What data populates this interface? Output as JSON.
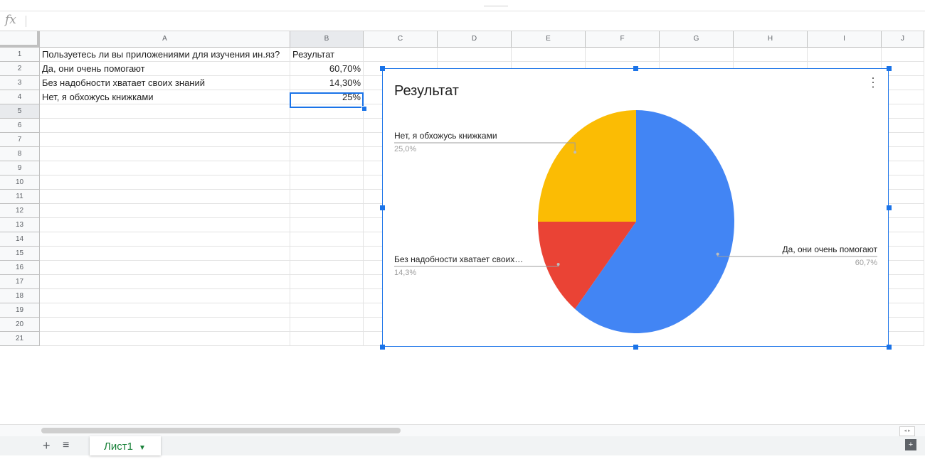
{
  "formula_bar": {
    "label": "fx",
    "value": ""
  },
  "sheet": {
    "columns": [
      "A",
      "B",
      "C",
      "D",
      "E",
      "F",
      "G",
      "H",
      "I",
      "J"
    ],
    "rows": [
      "1",
      "2",
      "3",
      "4",
      "5",
      "6",
      "7",
      "8",
      "9",
      "10",
      "11",
      "12",
      "13",
      "14",
      "15",
      "16",
      "17",
      "18",
      "19",
      "20",
      "21"
    ],
    "cells": {
      "A1": "Пользуетесь ли вы приложениями для изучения ин.яз?",
      "B1": "Результат",
      "A2": "Да, они очень помогают",
      "B2": "60,70%",
      "A3": "Без надобности хватает своих знаний",
      "B3": "14,30%",
      "A4": "Нет, я обхожусь книжками",
      "B4": "25%"
    },
    "selected_cell": "B5"
  },
  "chart": {
    "title": "Результат",
    "menu_icon": "more-vert-icon",
    "colors": [
      "#4285f4",
      "#ea4335",
      "#fbbc04"
    ]
  },
  "chart_data": {
    "type": "pie",
    "title": "Результат",
    "categories": [
      "Да, они очень помогают",
      "Без надобности хватает своих знаний",
      "Нет, я обхожусь книжками"
    ],
    "values": [
      60.7,
      14.3,
      25.0
    ],
    "labels": [
      "Да, они очень помогают",
      "Без надобности хватает своих…",
      "Нет, я обхожусь книжками"
    ],
    "percent_labels": [
      "60,7%",
      "14,3%",
      "25,0%"
    ],
    "colors": [
      "#4285f4",
      "#ea4335",
      "#fbbc04"
    ],
    "legend": "labeled"
  },
  "bottom": {
    "add_icon": "plus-icon",
    "list_icon": "list-icon",
    "tab_label": "Лист1",
    "explore_icon": "explore-icon"
  }
}
